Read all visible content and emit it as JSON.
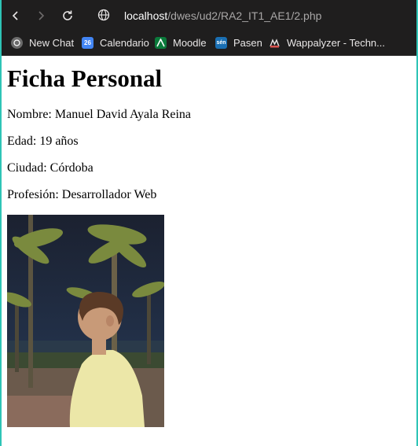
{
  "browser": {
    "url_host": "localhost",
    "url_path": "/dwes/ud2/RA2_IT1_AE1/2.php"
  },
  "bookmarks": [
    {
      "label": "New Chat",
      "icon": "chatgpt-icon"
    },
    {
      "label": "Calendario",
      "icon": "calendar-icon"
    },
    {
      "label": "Moodle",
      "icon": "moodle-icon"
    },
    {
      "label": "Pasen",
      "icon": "pasen-icon"
    },
    {
      "label": "Wappalyzer - Techn...",
      "icon": "wappalyzer-icon"
    }
  ],
  "bookmark_fav_text": {
    "calendar": "26",
    "pasen": "sén"
  },
  "page": {
    "title": "Ficha Personal",
    "nombre": "Nombre: Manuel David Ayala Reina",
    "edad": "Edad: 19 años",
    "ciudad": "Ciudad: Córdoba",
    "profesion": "Profesión: Desarrollador Web"
  },
  "colors": {
    "accent": "#2ec4b6",
    "toolbar_bg": "#1f1e1e"
  }
}
